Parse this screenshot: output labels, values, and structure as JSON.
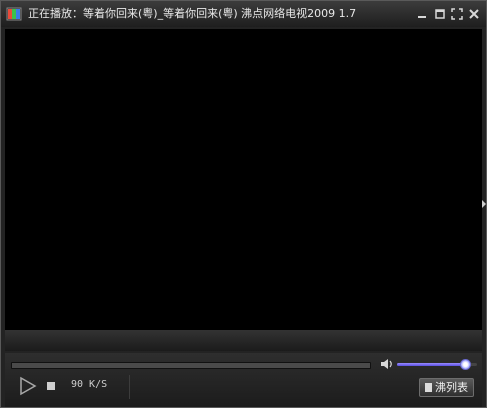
{
  "window": {
    "title": "正在播放：等着你回来(粤)_等着你回来(粤)  沸点网络电视2009 1.7",
    "icon": "app-tv-icon",
    "buttons": [
      "minimize-icon",
      "restore-icon",
      "fullscreen-icon",
      "close-icon"
    ]
  },
  "player": {
    "seek_progress": 0.0,
    "volume_level": 0.85,
    "speed_text": "90 K/S",
    "playlist_label": "沸列表"
  },
  "colors": {
    "screen": "#000000",
    "volume_accent": "#6a5cf0",
    "chrome": "#232323"
  }
}
